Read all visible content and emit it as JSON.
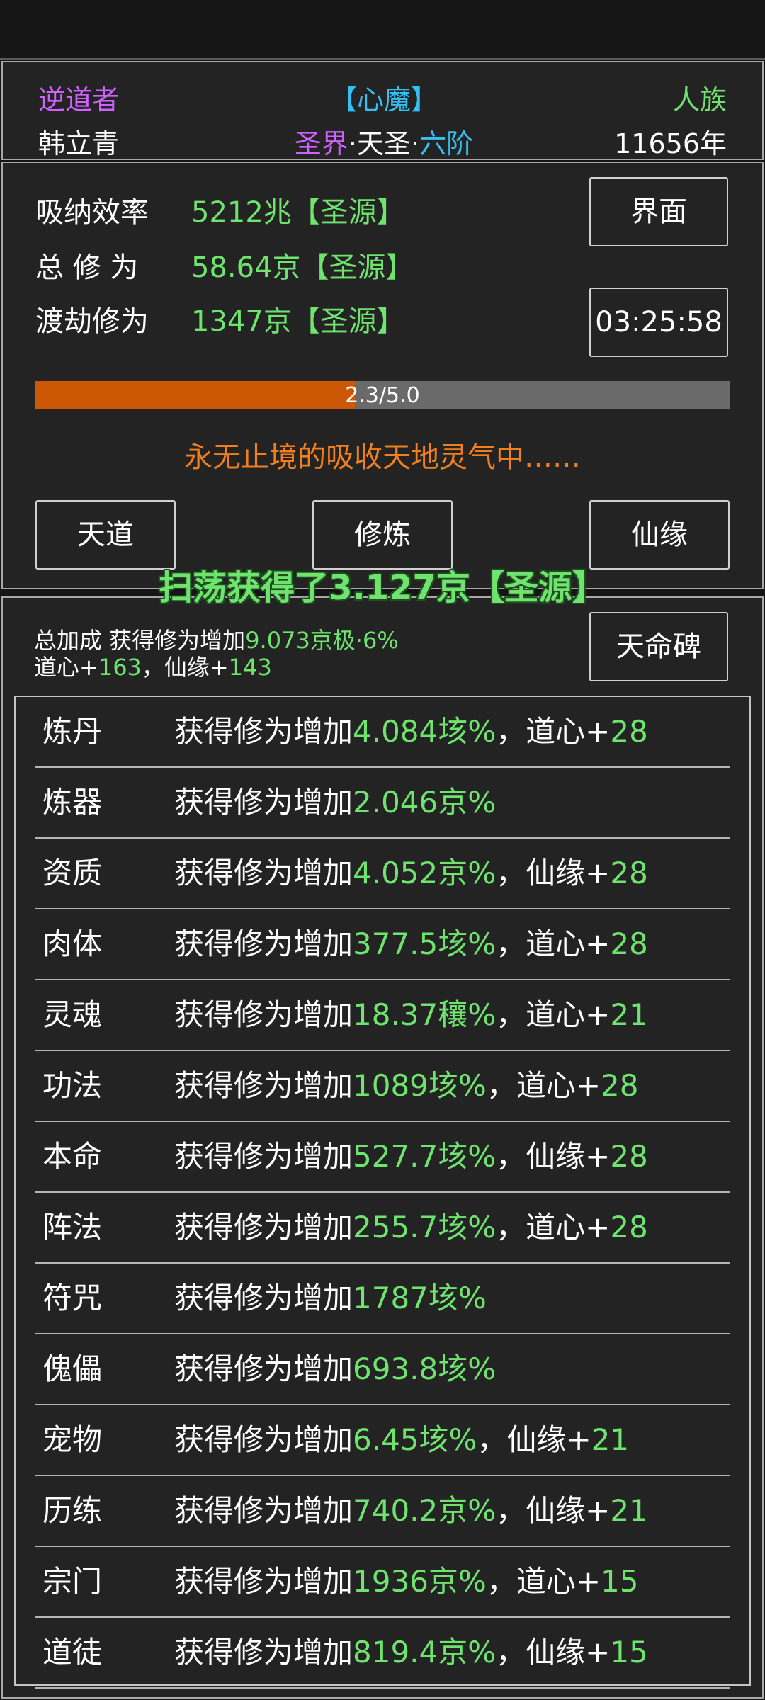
{
  "profile": {
    "title": "逆道者",
    "state": "【心魔】",
    "race": "人族",
    "name": "韩立青",
    "realm_main": "圣界",
    "realm_sep1": "·",
    "realm_mid": "天圣",
    "realm_sep2": "·",
    "realm_stage": "六阶",
    "age": "11656年"
  },
  "stats": {
    "absorb_label": "吸纳效率",
    "absorb_value": "5212兆【圣源】",
    "total_label": "总 修 为",
    "total_value": "58.64京【圣源】",
    "tribulation_label": "渡劫修为",
    "tribulation_value": "1347京【圣源】",
    "interface_button": "界面",
    "timer": "03:25:58",
    "progress_text": "2.3/5.0",
    "progress_fraction": 0.46,
    "status_message": "永无止境的吸收天地灵气中……"
  },
  "nav": {
    "tiandao": "天道",
    "xiulian": "修炼",
    "xianyuan": "仙缘"
  },
  "sweep_message": "扫荡获得了3.127京【圣源】",
  "bonus": {
    "total_prefix": "总加成 获得修为增加",
    "total_value": "9.073京极·6%",
    "daoxin_label": "道心+",
    "daoxin_value": "163",
    "comma": "，",
    "xianyuan_label": "仙缘+",
    "xianyuan_value": "143",
    "tianming_button": "天命碑"
  },
  "bonus_rows": [
    {
      "name": "炼丹",
      "prefix": "获得修为增加",
      "value": "4.084垓%",
      "extra_label": "，道心+",
      "extra_value": "28"
    },
    {
      "name": "炼器",
      "prefix": "获得修为增加",
      "value": "2.046京%",
      "extra_label": "",
      "extra_value": ""
    },
    {
      "name": "资质",
      "prefix": "获得修为增加",
      "value": "4.052京%",
      "extra_label": "，仙缘+",
      "extra_value": "28"
    },
    {
      "name": "肉体",
      "prefix": "获得修为增加",
      "value": "377.5垓%",
      "extra_label": "，道心+",
      "extra_value": "28"
    },
    {
      "name": "灵魂",
      "prefix": "获得修为增加",
      "value": "18.37穰%",
      "extra_label": "，道心+",
      "extra_value": "21"
    },
    {
      "name": "功法",
      "prefix": "获得修为增加",
      "value": "1089垓%",
      "extra_label": "，道心+",
      "extra_value": "28"
    },
    {
      "name": "本命",
      "prefix": "获得修为增加",
      "value": "527.7垓%",
      "extra_label": "，仙缘+",
      "extra_value": "28"
    },
    {
      "name": "阵法",
      "prefix": "获得修为增加",
      "value": "255.7垓%",
      "extra_label": "，道心+",
      "extra_value": "28"
    },
    {
      "name": "符咒",
      "prefix": "获得修为增加",
      "value": "1787垓%",
      "extra_label": "",
      "extra_value": ""
    },
    {
      "name": "傀儡",
      "prefix": "获得修为增加",
      "value": "693.8垓%",
      "extra_label": "",
      "extra_value": ""
    },
    {
      "name": "宠物",
      "prefix": "获得修为增加",
      "value": "6.45垓%",
      "extra_label": "，仙缘+",
      "extra_value": "21"
    },
    {
      "name": "历练",
      "prefix": "获得修为增加",
      "value": "740.2京%",
      "extra_label": "，仙缘+",
      "extra_value": "21"
    },
    {
      "name": "宗门",
      "prefix": "获得修为增加",
      "value": "1936京%",
      "extra_label": "，道心+",
      "extra_value": "15"
    },
    {
      "name": "道徒",
      "prefix": "获得修为增加",
      "value": "819.4京%",
      "extra_label": "，仙缘+",
      "extra_value": "15"
    }
  ],
  "colors": {
    "accent_green": "#6ee36e",
    "title_purple": "#cf63ff",
    "state_cyan": "#34c0f3",
    "status_orange": "#f07f1e",
    "progress_orange": "#cc5805",
    "panel_bg": "#232323"
  }
}
